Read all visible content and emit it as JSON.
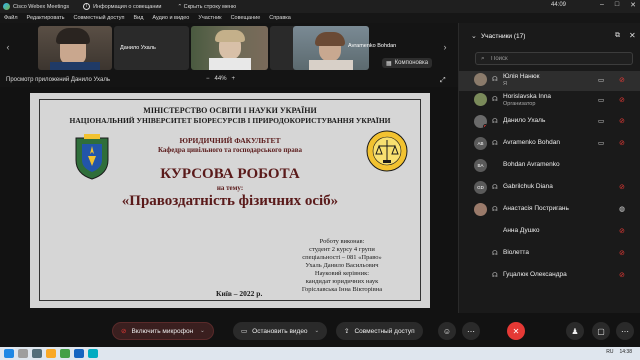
{
  "app": {
    "title": "Cisco Webex Meetings",
    "info_label": "Информация о совещании",
    "hide_bar_label": "Скрыть строку меню",
    "clock": "44:09"
  },
  "menu": [
    "Файл",
    "Редактировать",
    "Совместный доступ",
    "Вид",
    "Аудио и видео",
    "Участник",
    "Совещание",
    "Справка"
  ],
  "video_strip": {
    "tiles": [
      {
        "name": ""
      },
      {
        "name": "Данило Ухаль"
      },
      {
        "name": ""
      },
      {
        "name": "Avramenko Bohdan"
      }
    ],
    "compact_label": "Компоновка"
  },
  "share_header": {
    "view_label": "Просмотр приложений Данило Ухаль",
    "zoom_minus": "−",
    "zoom_value": "44%",
    "zoom_plus": "+"
  },
  "slide": {
    "ministry": "МІНІСТЕРСТВО ОСВІТИ І НАУКИ УКРАЇНИ",
    "university": "НАЦІОНАЛЬНИЙ УНІВЕРСИТЕТ БІОРЕСУРСІВ І ПРИРОДОКОРИСТУВАННЯ УКРАЇНИ",
    "faculty": "ЮРИДИЧНИЙ ФАКУЛЬТЕТ",
    "department": "Кафедра цивільного та господарського права",
    "work_type": "КУРСОВА РОБОТА",
    "on_topic": "на тему:",
    "topic": "«Правоздатність фізичних осіб»",
    "author_lines": [
      "Роботу виконав:",
      "студент 2 курсу 4 групи",
      "спеціальності – 081 «Право»",
      "Ухаль Данило Васильович",
      "Науковий керівник:",
      "кандидат юридичних наук",
      "Горіславська Інна Вікторівна"
    ],
    "city_year": "Київ – 2022 р."
  },
  "sidebar": {
    "title": "Участники (17)",
    "search_placeholder": "Поиск",
    "participants": [
      {
        "name": "Юлія Нанюк",
        "role": "Я",
        "initials": "",
        "photo": true,
        "selected": true,
        "cam": true,
        "mic": "muted"
      },
      {
        "name": "Horislavska Inna",
        "role": "Организатор",
        "initials": "",
        "photo": true,
        "selected": false,
        "cam": true,
        "mic": "muted"
      },
      {
        "name": "Данило Ухаль",
        "role": "",
        "initials": "",
        "photo": false,
        "selected": false,
        "cam": true,
        "mic": "muted"
      },
      {
        "name": "Avramenko Bohdan",
        "role": "",
        "initials": "AB",
        "photo": false,
        "selected": false,
        "cam": true,
        "mic": "muted"
      },
      {
        "name": "Bohdan Avramenko",
        "role": "",
        "initials": "BA",
        "photo": false,
        "selected": false,
        "cam": false,
        "mic": "none"
      },
      {
        "name": "Gabrilchuk Diana",
        "role": "",
        "initials": "GD",
        "photo": false,
        "selected": false,
        "cam": false,
        "mic": "muted"
      },
      {
        "name": "Анастасія Постригань",
        "role": "",
        "initials": "",
        "photo": true,
        "selected": false,
        "cam": false,
        "mic": "active"
      },
      {
        "name": "Анна Душко",
        "role": "",
        "initials": "",
        "photo": false,
        "selected": false,
        "cam": false,
        "mic": "muted"
      },
      {
        "name": "Віолетта",
        "role": "",
        "initials": "",
        "photo": false,
        "selected": false,
        "cam": false,
        "mic": "muted"
      },
      {
        "name": "Гуцалюк Олександра",
        "role": "",
        "initials": "",
        "photo": false,
        "selected": false,
        "cam": false,
        "mic": "muted"
      }
    ]
  },
  "controls": {
    "unmute_label": "Включить микрофон",
    "stop_video_label": "Остановить видео",
    "share_label": "Совместный доступ"
  },
  "taskbar": {
    "time": "14:38",
    "lang": "RU"
  },
  "colors": {
    "end_call": "#e53935",
    "muted_mic": "#e53935",
    "background": "#121212",
    "slide_bg": "#d6d6d6"
  }
}
